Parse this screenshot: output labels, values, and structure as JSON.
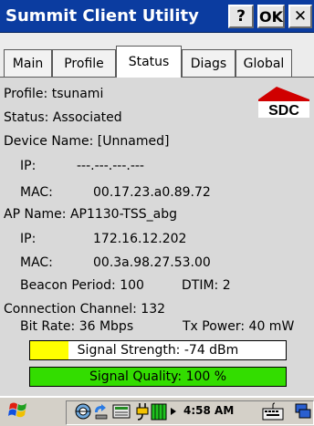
{
  "window": {
    "title": "Summit Client Utility",
    "help_label": "?",
    "ok_label": "OK",
    "close_label": "✕"
  },
  "tabs": [
    {
      "label": "Main"
    },
    {
      "label": "Profile"
    },
    {
      "label": "Status",
      "active": true
    },
    {
      "label": "Diags"
    },
    {
      "label": "Global"
    }
  ],
  "logo_text": "SDC",
  "status": {
    "profile": "Profile: tsunami",
    "status": "Status: Associated",
    "device_name": "Device Name: [Unnamed]",
    "ip_label": "IP:",
    "ip_value": "---.---.---.---",
    "mac_label": "MAC:",
    "mac_value": "00.17.23.a0.89.72",
    "ap_name": "AP Name: AP1130-TSS_abg",
    "ap_ip_label": "IP:",
    "ap_ip_value": "172.16.12.202",
    "ap_mac_label": "MAC:",
    "ap_mac_value": "00.3a.98.27.53.00",
    "beacon": "Beacon Period: 100",
    "dtim": "DTIM: 2",
    "connection_channel": "Connection Channel:  132",
    "bit_rate": "Bit Rate: 36 Mbps",
    "tx_power": "Tx Power:  40 mW"
  },
  "signal_strength": {
    "label": "Signal Strength: -74 dBm",
    "fill_fraction": 0.15,
    "color": "#ffff00"
  },
  "signal_quality": {
    "label": "Signal Quality: 100 %",
    "fill_fraction": 1.0,
    "color": "#33dd00"
  },
  "taskbar": {
    "clock": "4:58 AM",
    "icons": [
      "start-flag-icon",
      "network-icon",
      "sync-icon",
      "input-icon",
      "power-plug-icon",
      "battery-icon",
      "arrow-icon",
      "keyboard-icon",
      "desktop-icon"
    ]
  }
}
